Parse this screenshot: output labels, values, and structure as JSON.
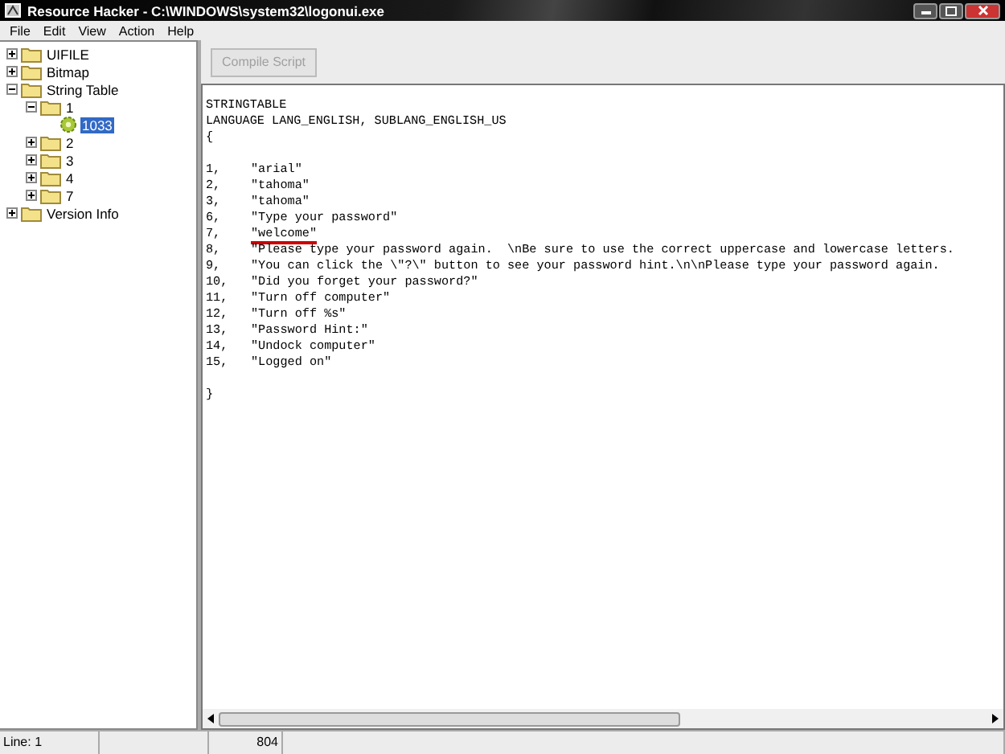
{
  "window": {
    "title": "Resource Hacker  -  C:\\WINDOWS\\system32\\logonui.exe"
  },
  "menu": [
    "File",
    "Edit",
    "View",
    "Action",
    "Help"
  ],
  "tree": [
    {
      "label": "UIFILE",
      "kind": "folder",
      "expanded": false,
      "selected": false
    },
    {
      "label": "Bitmap",
      "kind": "folder",
      "expanded": false,
      "selected": false
    },
    {
      "label": "String Table",
      "kind": "folder",
      "expanded": true,
      "selected": false,
      "children": [
        {
          "label": "1",
          "kind": "folder",
          "expanded": true,
          "selected": false,
          "children": [
            {
              "label": "1033",
              "kind": "resource",
              "selected": true
            }
          ]
        },
        {
          "label": "2",
          "kind": "folder",
          "expanded": false,
          "selected": false
        },
        {
          "label": "3",
          "kind": "folder",
          "expanded": false,
          "selected": false
        },
        {
          "label": "4",
          "kind": "folder",
          "expanded": false,
          "selected": false
        },
        {
          "label": "7",
          "kind": "folder",
          "expanded": false,
          "selected": false
        }
      ]
    },
    {
      "label": "Version Info",
      "kind": "folder",
      "expanded": false,
      "selected": false
    }
  ],
  "toolbar": {
    "compile_button": {
      "label": "Compile Script",
      "disabled": true
    }
  },
  "script": {
    "header": [
      "STRINGTABLE",
      "LANGUAGE LANG_ENGLISH, SUBLANG_ENGLISH_US",
      "{"
    ],
    "entries": [
      {
        "id": "1,",
        "value": "\"arial\"",
        "underlined": false
      },
      {
        "id": "2,",
        "value": "\"tahoma\"",
        "underlined": false
      },
      {
        "id": "3,",
        "value": "\"tahoma\"",
        "underlined": false
      },
      {
        "id": "6,",
        "value": "\"Type your password\"",
        "underlined": false
      },
      {
        "id": "7,",
        "value": "\"welcome\"",
        "underlined": true
      },
      {
        "id": "8,",
        "value": "\"Please type your password again.  \\nBe sure to use the correct uppercase and lowercase letters.",
        "underlined": false
      },
      {
        "id": "9,",
        "value": "\"You can click the \\\"?\\\" button to see your password hint.\\n\\nPlease type your password again.",
        "underlined": false
      },
      {
        "id": "10,",
        "value": "\"Did you forget your password?\"",
        "underlined": false
      },
      {
        "id": "11,",
        "value": "\"Turn off computer\"",
        "underlined": false
      },
      {
        "id": "12,",
        "value": "\"Turn off %s\"",
        "underlined": false
      },
      {
        "id": "13,",
        "value": "\"Password Hint:\"",
        "underlined": false
      },
      {
        "id": "14,",
        "value": "\"Undock computer\"",
        "underlined": false
      },
      {
        "id": "15,",
        "value": "\"Logged on\"",
        "underlined": false
      }
    ],
    "footer": [
      "}"
    ]
  },
  "status_bar": {
    "line": "Line: 1",
    "size": "804"
  }
}
